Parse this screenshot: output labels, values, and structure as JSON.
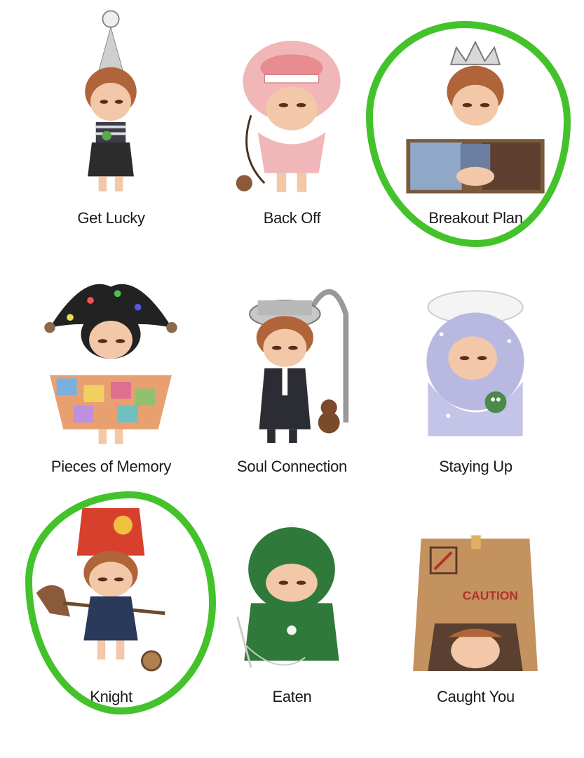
{
  "figures": [
    {
      "name": "Get Lucky"
    },
    {
      "name": "Back Off"
    },
    {
      "name": "Breakout Plan"
    },
    {
      "name": "Pieces of Memory"
    },
    {
      "name": "Soul Connection"
    },
    {
      "name": "Staying Up"
    },
    {
      "name": "Knight"
    },
    {
      "name": "Eaten"
    },
    {
      "name": "Caught You"
    }
  ],
  "highlight_color": "#44c22b",
  "highlighted": [
    "Breakout Plan",
    "Knight"
  ],
  "box_label": "CAUTION"
}
